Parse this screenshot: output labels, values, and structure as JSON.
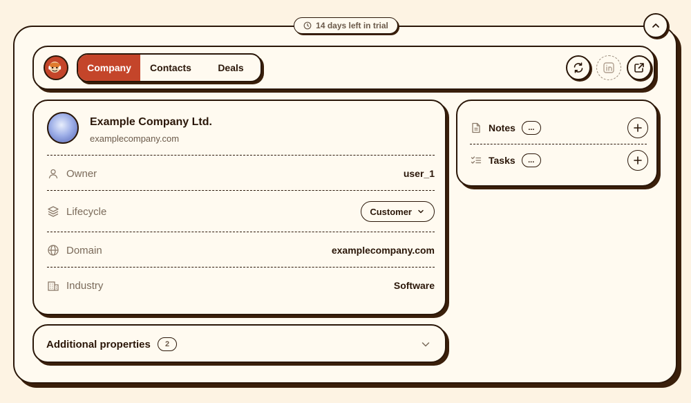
{
  "trial": {
    "text": "14 days left in trial"
  },
  "header": {
    "tabs": [
      {
        "label": "Company",
        "active": true
      },
      {
        "label": "Contacts",
        "active": false
      },
      {
        "label": "Deals",
        "active": false
      }
    ],
    "actions": [
      "refresh-icon",
      "linkedin-icon",
      "external-link-icon"
    ]
  },
  "company": {
    "name": "Example Company Ltd.",
    "domain_sub": "examplecompany.com",
    "properties": {
      "owner": {
        "label": "Owner",
        "value": "user_1",
        "icon": "user-icon"
      },
      "lifecycle": {
        "label": "Lifecycle",
        "value": "Customer",
        "icon": "layers-icon"
      },
      "domain": {
        "label": "Domain",
        "value": "examplecompany.com",
        "icon": "globe-icon"
      },
      "industry": {
        "label": "Industry",
        "value": "Software",
        "icon": "building-icon"
      }
    }
  },
  "additional": {
    "title": "Additional properties",
    "count": "2"
  },
  "side": {
    "notes": {
      "label": "Notes",
      "more": "..."
    },
    "tasks": {
      "label": "Tasks",
      "more": "..."
    }
  },
  "colors": {
    "accent": "#c4452a",
    "background": "#fdf3e3",
    "card": "#fffaf0",
    "ink": "#2a1608"
  }
}
